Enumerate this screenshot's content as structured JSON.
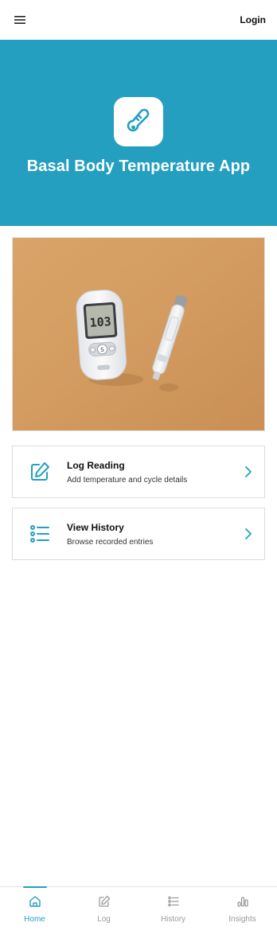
{
  "header": {
    "login_label": "Login",
    "menu_icon": "hamburger-menu-icon"
  },
  "hero": {
    "title": "Basal Body Temperature App",
    "icon": "thermometer-icon",
    "bg_color": "#249fc0"
  },
  "photo": {
    "icon": "glucose-meter-photo",
    "meter_reading": "103"
  },
  "cards": [
    {
      "title": "Log Reading",
      "subtitle": "Add temperature and cycle details",
      "icon": "edit-pencil-icon"
    },
    {
      "title": "View History",
      "subtitle": "Browse recorded entries",
      "icon": "list-icon"
    }
  ],
  "tabs": [
    {
      "label": "Home",
      "icon": "home-icon",
      "active": true
    },
    {
      "label": "Log",
      "icon": "edit-pencil-icon",
      "active": false
    },
    {
      "label": "History",
      "icon": "list-icon",
      "active": false
    },
    {
      "label": "Insights",
      "icon": "bar-chart-icon",
      "active": false
    }
  ],
  "accent_color": "#249fc0"
}
